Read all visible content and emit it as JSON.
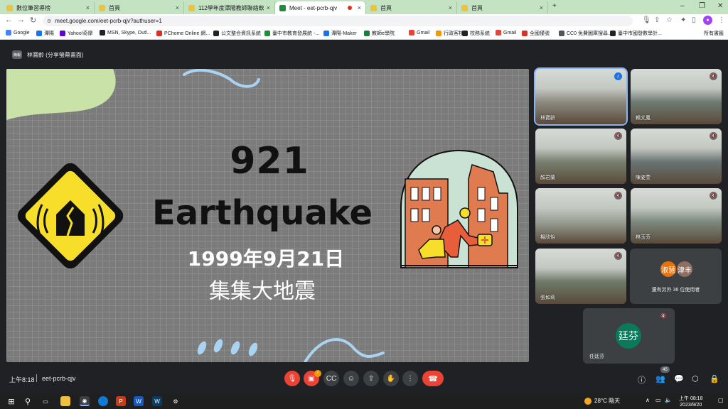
{
  "browser": {
    "tabs": [
      {
        "label": "數位筆習導榜",
        "active": false
      },
      {
        "label": "首頁",
        "active": false
      },
      {
        "label": "112學年度潭陽教師聯絡軟窗",
        "active": false
      },
      {
        "label": "Meet - eet-pcrb-qjv",
        "active": true
      },
      {
        "label": "首頁",
        "active": false
      },
      {
        "label": "首頁",
        "active": false
      }
    ],
    "new_tab": "+",
    "url": "meet.google.com/eet-pcrb-qjv?authuser=1",
    "profile_initial": "●",
    "bookmarks": [
      {
        "label": "Google",
        "color": "#4285f4"
      },
      {
        "label": "潭陽",
        "color": "#1a73e8"
      },
      {
        "label": "Yahoo!奇摩",
        "color": "#6001d2"
      },
      {
        "label": "MSN, Skype, Outl...",
        "color": "#222"
      },
      {
        "label": "PChome Online 網...",
        "color": "#d93025"
      },
      {
        "label": "公文整合資訊系統",
        "color": "#222"
      },
      {
        "label": "臺中市教育發展統 -...",
        "color": "#1e8e3e"
      },
      {
        "label": "潭陽-Maker",
        "color": "#1a73e8"
      },
      {
        "label": "教師e學院",
        "color": "#188038"
      },
      {
        "label": "Gmail",
        "color": "#ea4335"
      },
      {
        "label": "行政客棧",
        "color": "#f29900"
      },
      {
        "label": "校務系統",
        "color": "#222"
      },
      {
        "label": "Gmail",
        "color": "#ea4335"
      },
      {
        "label": "全國僅號",
        "color": "#d93025"
      },
      {
        "label": "CC0 免費圖庫搜尋...",
        "color": "#555"
      },
      {
        "label": "臺中市國發數學計...",
        "color": "#222"
      }
    ],
    "all_bookmarks": "所有書籤"
  },
  "meet": {
    "presenter_badge": "簡報",
    "presenter_label": "林寶齡 (分享螢幕畫面)",
    "slide": {
      "title_num": "921",
      "title_word": "Earthquake",
      "date": "1999年9月21日",
      "subtitle": "集集大地震",
      "colors": {
        "sign_yellow": "#f7de2a",
        "building": "#e07a4f",
        "blob_green": "#c8e2a8",
        "blob_blue": "#a9d3f0"
      }
    },
    "participants": [
      {
        "name": "林寶齡",
        "speaking": true
      },
      {
        "name": "賴文鳳",
        "speaking": false
      },
      {
        "name": "顏君蘭",
        "speaking": false
      },
      {
        "name": "陳姿萱",
        "speaking": false
      },
      {
        "name": "楊欣怡",
        "speaking": false
      },
      {
        "name": "林玉芬",
        "speaking": false
      },
      {
        "name": "張如莉",
        "speaking": false
      }
    ],
    "others": {
      "avatars": [
        {
          "text": "淑慧",
          "color": "#e8710a"
        },
        {
          "text": "津丰",
          "color": "#8d6e63"
        }
      ],
      "text": "還有另外 36 位使用者"
    },
    "self": {
      "avatar": "廷芬",
      "name": "任廷芬"
    },
    "time": "上午8:18",
    "meeting_code": "eet-pcrb-qjv",
    "people_count": "45",
    "camera_badge": "!"
  },
  "taskbar": {
    "weather": "28°C 陰天",
    "time": "上午 08:18",
    "date": "2023/9/20"
  }
}
